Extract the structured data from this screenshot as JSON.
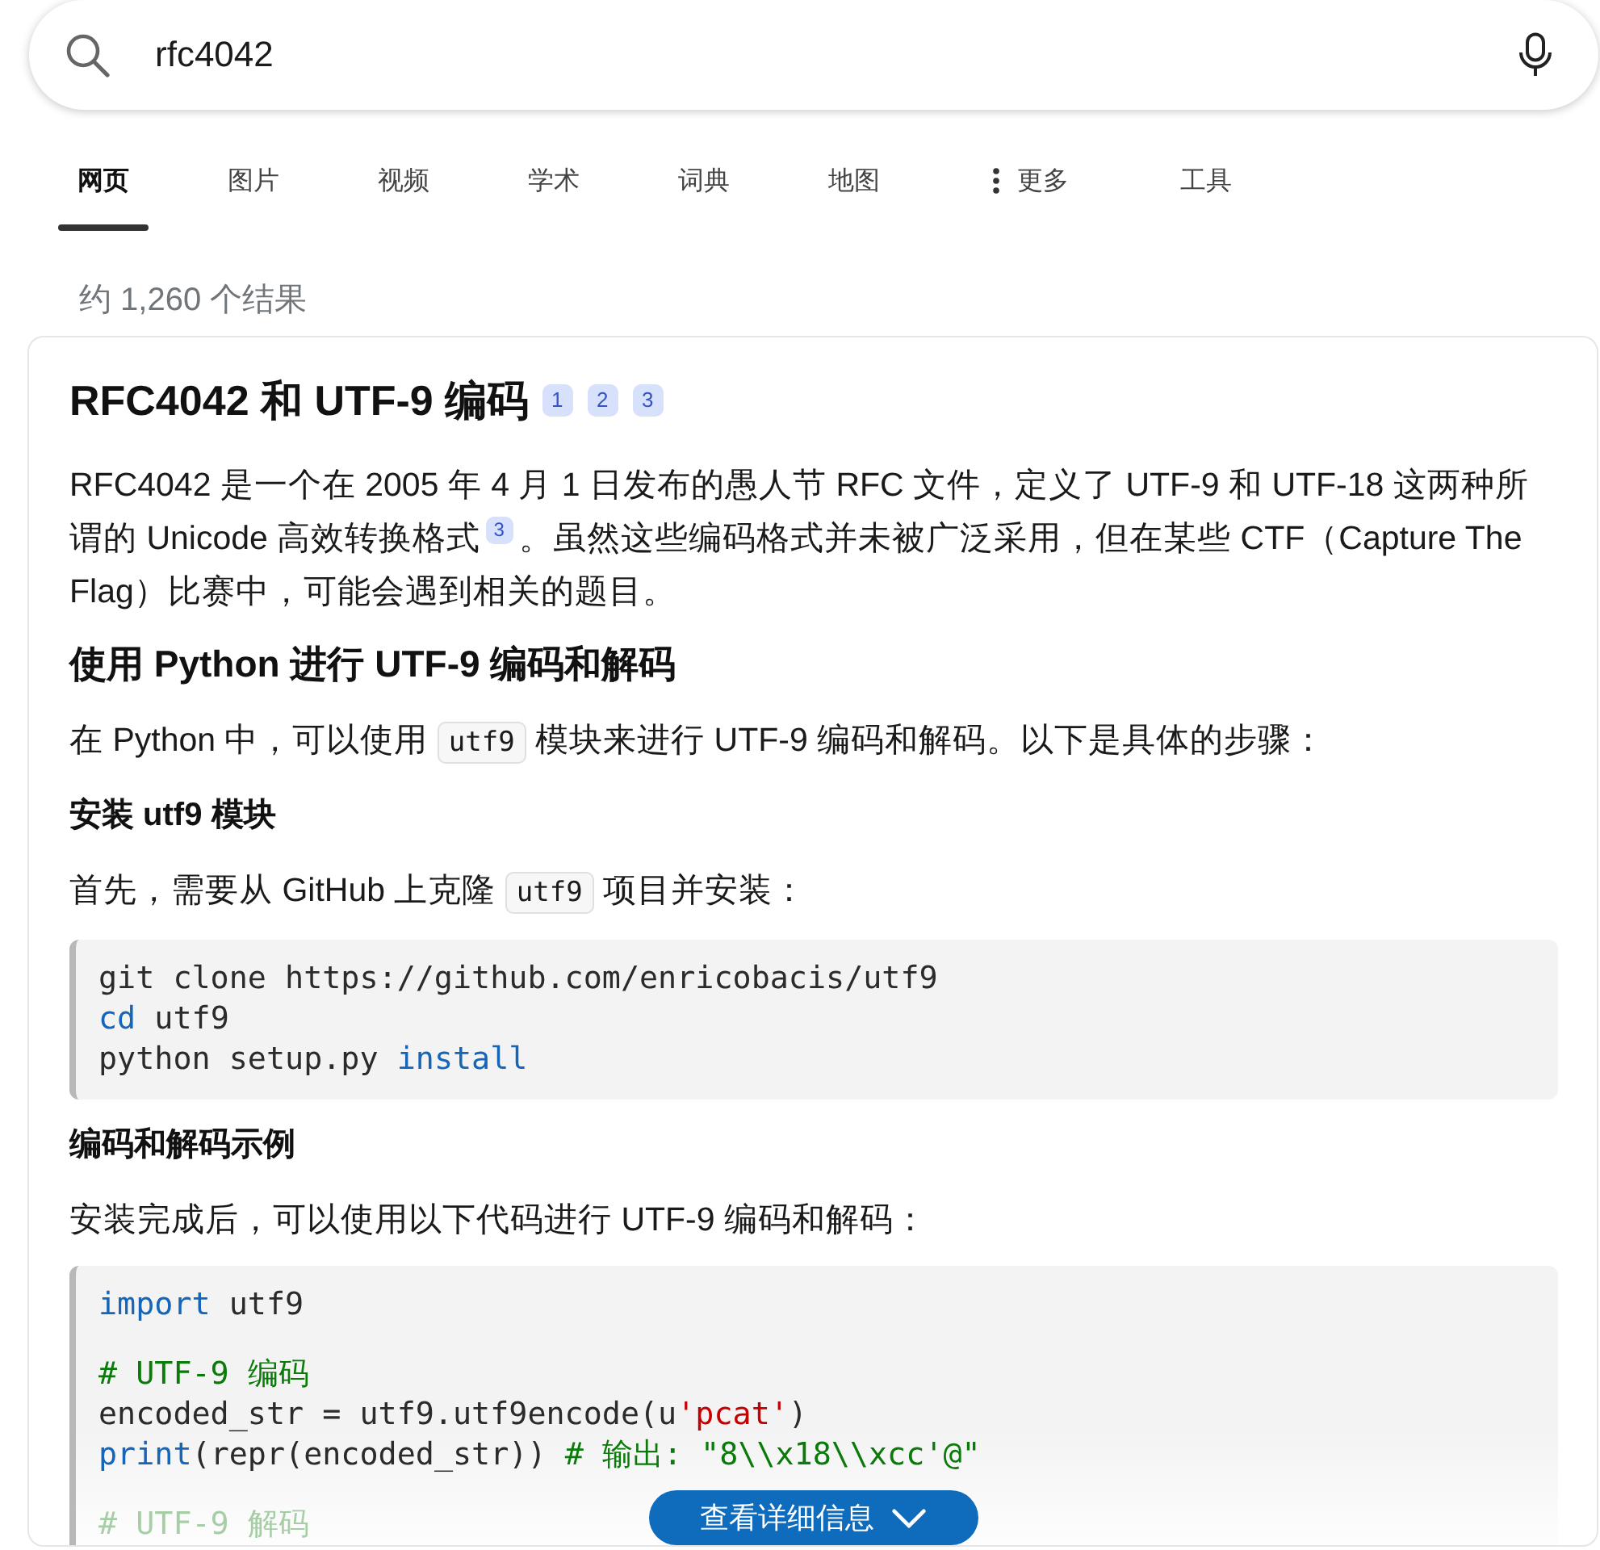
{
  "search": {
    "value": "rfc4042"
  },
  "tabs": [
    {
      "label": "网页",
      "kind": "plain",
      "selected": true
    },
    {
      "label": "图片",
      "kind": "plain",
      "selected": false
    },
    {
      "label": "视频",
      "kind": "plain",
      "selected": false
    },
    {
      "label": "学术",
      "kind": "plain",
      "selected": false
    },
    {
      "label": "词典",
      "kind": "plain",
      "selected": false
    },
    {
      "label": "地图",
      "kind": "plain",
      "selected": false
    },
    {
      "label": "更多",
      "kind": "menu",
      "selected": false
    },
    {
      "label": "工具",
      "kind": "plain",
      "selected": false
    }
  ],
  "result_count": "约 1,260 个结果",
  "answer": {
    "title": "RFC4042 和 UTF-9 编码",
    "citations": [
      "1",
      "2",
      "3"
    ],
    "blocks": [
      {
        "kind": "paragraph",
        "segments": [
          {
            "kind": "text",
            "text": "RFC4042 是一个在 2005 年 4 月 1 日发布的愚人节 RFC 文件，定义了 UTF-9 和 UTF-18 这两种所谓的 Unicode 高效转换格式"
          },
          {
            "kind": "citation",
            "text": "3"
          },
          {
            "kind": "text",
            "text": "。虽然这些编码格式并未被广泛采用，但在某些 CTF（Capture The Flag）比赛中，可能会遇到相关的题目。"
          }
        ]
      },
      {
        "kind": "heading",
        "text": "使用 Python 进行 UTF-9 编码和解码"
      },
      {
        "kind": "paragraph",
        "segments": [
          {
            "kind": "text",
            "text": "在 Python 中，可以使用 "
          },
          {
            "kind": "code",
            "text": "utf9"
          },
          {
            "kind": "text",
            "text": " 模块来进行 UTF-9 编码和解码。以下是具体的步骤："
          }
        ]
      },
      {
        "kind": "subheading",
        "text": "安装 utf9 模块"
      },
      {
        "kind": "paragraph",
        "segments": [
          {
            "kind": "text",
            "text": "首先，需要从 GitHub 上克隆 "
          },
          {
            "kind": "code",
            "text": "utf9"
          },
          {
            "kind": "text",
            "text": " 项目并安装："
          }
        ]
      },
      {
        "kind": "code_block",
        "groups": [
          [
            {
              "tokens": [
                {
                  "kind": "plain",
                  "text": "git clone https://github.com/enricobacis/utf9"
                }
              ]
            },
            {
              "tokens": [
                {
                  "kind": "keyword",
                  "text": "cd"
                },
                {
                  "kind": "plain",
                  "text": " utf9"
                }
              ]
            },
            {
              "tokens": [
                {
                  "kind": "plain",
                  "text": "python setup.py "
                },
                {
                  "kind": "keyword",
                  "text": "install"
                }
              ]
            }
          ]
        ]
      },
      {
        "kind": "subheading",
        "text": "编码和解码示例"
      },
      {
        "kind": "paragraph",
        "segments": [
          {
            "kind": "text",
            "text": "安装完成后，可以使用以下代码进行 UTF-9 编码和解码："
          }
        ]
      },
      {
        "kind": "code_block",
        "groups": [
          [
            {
              "tokens": [
                {
                  "kind": "keyword",
                  "text": "import"
                },
                {
                  "kind": "plain",
                  "text": " utf9"
                }
              ]
            }
          ],
          [
            {
              "tokens": [
                {
                  "kind": "comment",
                  "text": "# UTF-9 编码"
                }
              ]
            },
            {
              "tokens": [
                {
                  "kind": "plain",
                  "text": "encoded_str = utf9.utf9encode(u"
                },
                {
                  "kind": "string",
                  "text": "'pcat'"
                },
                {
                  "kind": "plain",
                  "text": ")"
                }
              ]
            },
            {
              "tokens": [
                {
                  "kind": "keyword",
                  "text": "print"
                },
                {
                  "kind": "plain",
                  "text": "(repr(encoded_str)) "
                },
                {
                  "kind": "comment",
                  "text": "# 输出: \"8\\\\x18\\\\xcc'@\""
                }
              ]
            }
          ],
          [
            {
              "tokens": [
                {
                  "kind": "comment",
                  "text": "# UTF-9 解码"
                }
              ]
            }
          ]
        ]
      }
    ],
    "collapsed": true,
    "expand_button": "查看详细信息"
  }
}
